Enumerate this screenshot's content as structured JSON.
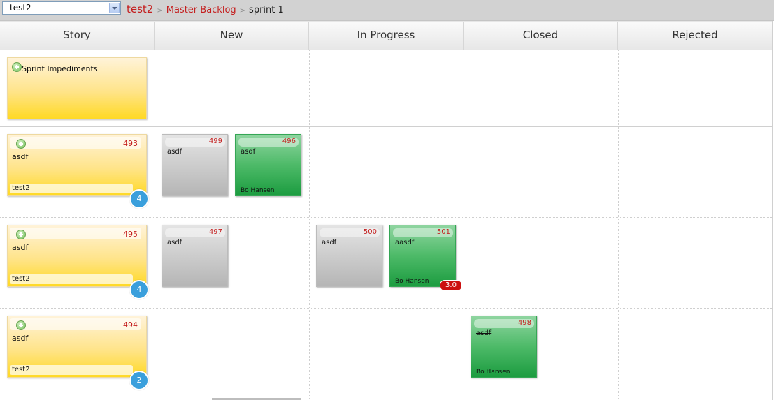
{
  "toolbar": {
    "project_select_value": "test2",
    "breadcrumb": {
      "project": "test2",
      "backlog": "Master Backlog",
      "sprint": "sprint 1",
      "separator": ">"
    }
  },
  "columns": [
    "Story",
    "New",
    "In Progress",
    "Closed",
    "Rejected"
  ],
  "rows": [
    {
      "story": {
        "title": "Sprint Impediments"
      }
    },
    {
      "story": {
        "id": "493",
        "title": "asdf",
        "owner": "test2",
        "task_count": "4"
      },
      "tasks": {
        "new": [
          {
            "id": "499",
            "title": "asdf",
            "owner": "",
            "color": "gray"
          },
          {
            "id": "496",
            "title": "asdf",
            "owner": "Bo Hansen",
            "color": "green"
          }
        ]
      }
    },
    {
      "story": {
        "id": "495",
        "title": "asdf",
        "owner": "test2",
        "task_count": "4"
      },
      "tasks": {
        "new": [
          {
            "id": "497",
            "title": "asdf",
            "owner": "",
            "color": "gray"
          }
        ],
        "in_progress": [
          {
            "id": "500",
            "title": "asdf",
            "owner": "",
            "color": "gray"
          },
          {
            "id": "501",
            "title": "aasdf",
            "owner": "Bo Hansen",
            "color": "green",
            "hours": "3.0"
          }
        ]
      }
    },
    {
      "story": {
        "id": "494",
        "title": "asdf",
        "owner": "test2",
        "task_count": "2"
      },
      "tasks": {
        "closed": [
          {
            "id": "498",
            "title": "asdf",
            "owner": "Bo Hansen",
            "color": "green",
            "strikethrough": true
          }
        ]
      }
    }
  ],
  "colors": {
    "breadcrumb_link": "#c41e1e",
    "story_card": "#ffd924",
    "task_open": "#b5b5b5",
    "task_assigned": "#1c9c40",
    "count_badge": "#3a9fdc",
    "hours_badge": "#cc1010"
  },
  "icons": {
    "add_task": "plus-icon",
    "dropdown": "chevron-down-icon"
  }
}
